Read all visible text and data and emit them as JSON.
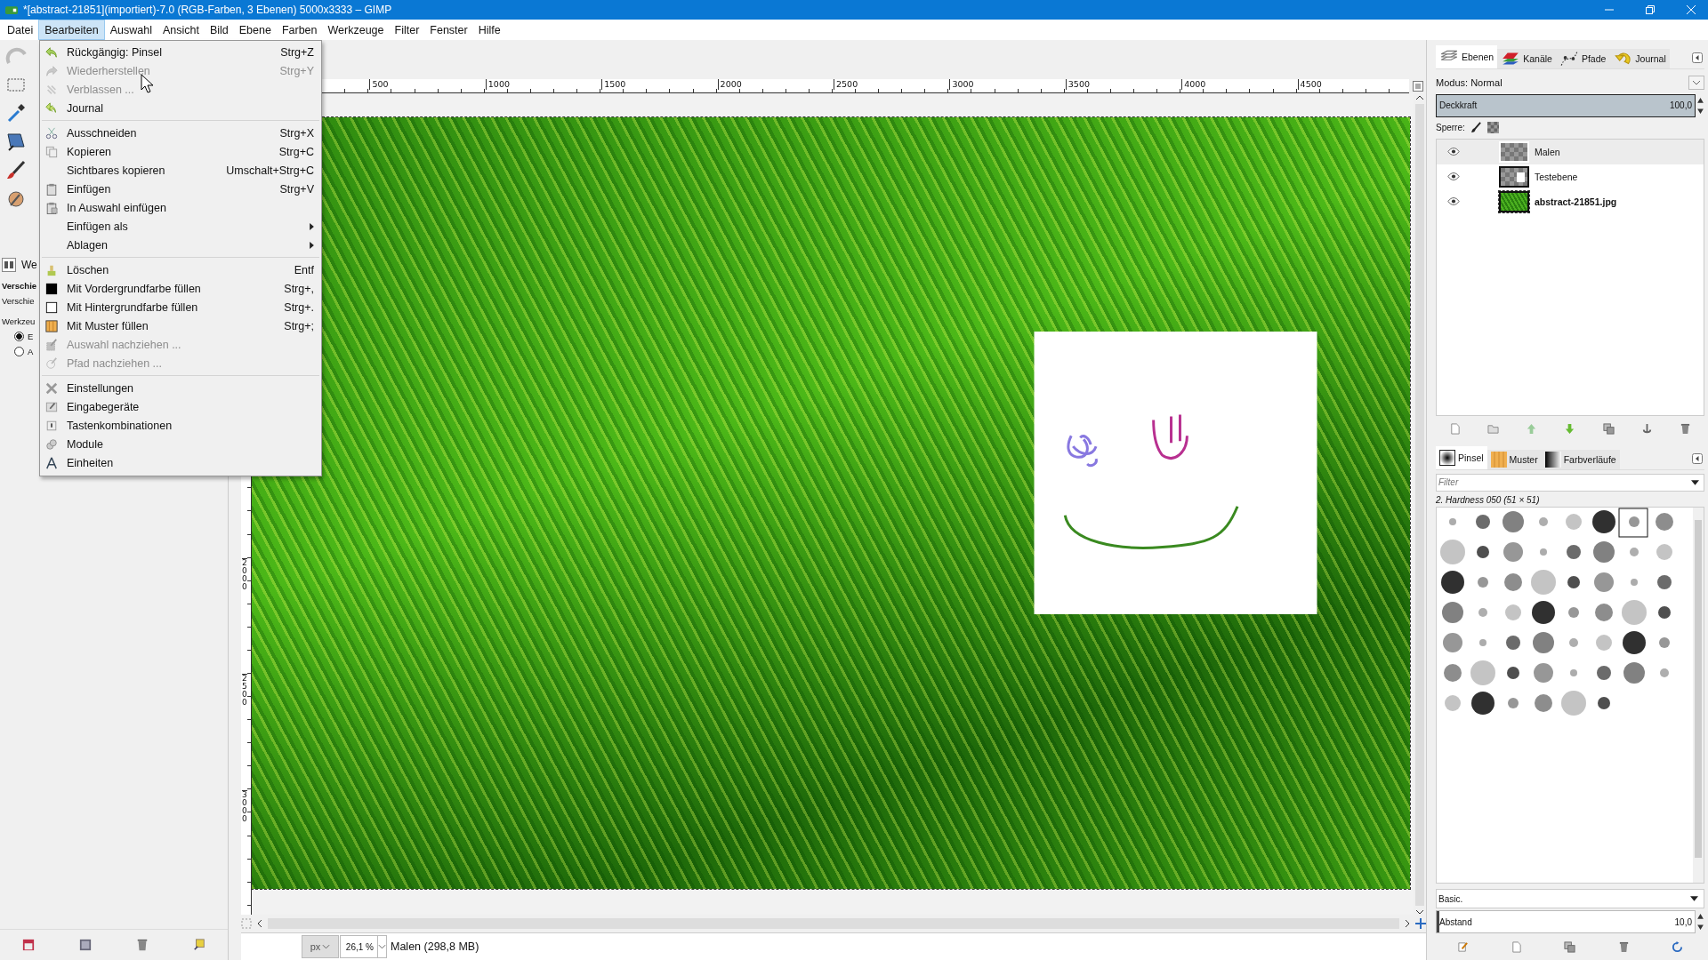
{
  "window": {
    "title": "*[abstract-21851](importiert)-7.0 (RGB-Farben, 3 Ebenen) 5000x3333 – GIMP"
  },
  "menubar": [
    {
      "label": "Datei",
      "selected": false
    },
    {
      "label": "Bearbeiten",
      "selected": true
    },
    {
      "label": "Auswahl",
      "selected": false
    },
    {
      "label": "Ansicht",
      "selected": false
    },
    {
      "label": "Bild",
      "selected": false
    },
    {
      "label": "Ebene",
      "selected": false
    },
    {
      "label": "Farben",
      "selected": false
    },
    {
      "label": "Werkzeuge",
      "selected": false
    },
    {
      "label": "Filter",
      "selected": false
    },
    {
      "label": "Fenster",
      "selected": false
    },
    {
      "label": "Hilfe",
      "selected": false
    }
  ],
  "edit_menu": {
    "sections": [
      [
        {
          "kind": "undo",
          "label": "Rückgängig: Pinsel",
          "shortcut": "Strg+Z",
          "disabled": false
        },
        {
          "kind": "redo",
          "label": "Wiederherstellen",
          "shortcut": "Strg+Y",
          "disabled": true
        },
        {
          "kind": "fade",
          "label": "Verblassen ...",
          "disabled": true
        },
        {
          "kind": "journal",
          "label": "Journal",
          "disabled": false
        }
      ],
      [
        {
          "kind": "cut",
          "label": "Ausschneiden",
          "shortcut": "Strg+X",
          "disabled": false
        },
        {
          "kind": "copy",
          "label": "Kopieren",
          "shortcut": "Strg+C",
          "disabled": false
        },
        {
          "kind": "plain",
          "label": "Sichtbares kopieren",
          "shortcut": "Umschalt+Strg+C",
          "disabled": false
        },
        {
          "kind": "paste",
          "label": "Einfügen",
          "shortcut": "Strg+V",
          "disabled": false
        },
        {
          "kind": "paste-into",
          "label": "In Auswahl einfügen",
          "disabled": false
        },
        {
          "kind": "plain",
          "label": "Einfügen als",
          "disabled": false,
          "submenu": true
        },
        {
          "kind": "plain",
          "label": "Ablagen",
          "disabled": false,
          "submenu": true
        }
      ],
      [
        {
          "kind": "clear",
          "label": "Löschen",
          "shortcut": "Entf",
          "disabled": false
        },
        {
          "kind": "fill-fg",
          "label": "Mit Vordergrundfarbe füllen",
          "shortcut": "Strg+,",
          "disabled": false
        },
        {
          "kind": "fill-bg",
          "label": "Mit Hintergrundfarbe füllen",
          "shortcut": "Strg+.",
          "disabled": false
        },
        {
          "kind": "fill-pattern",
          "label": "Mit Muster füllen",
          "shortcut": "Strg+;",
          "disabled": false
        },
        {
          "kind": "stroke-selection",
          "label": "Auswahl nachziehen ...",
          "disabled": true
        },
        {
          "kind": "stroke-path",
          "label": "Pfad nachziehen ...",
          "disabled": true
        }
      ],
      [
        {
          "kind": "preferences",
          "label": "Einstellungen",
          "disabled": false
        },
        {
          "kind": "input-devices",
          "label": "Eingabegeräte",
          "disabled": false
        },
        {
          "kind": "shortcuts",
          "label": "Tastenkombinationen",
          "disabled": false
        },
        {
          "kind": "modules",
          "label": "Module",
          "disabled": false
        },
        {
          "kind": "units",
          "label": "Einheiten",
          "disabled": false
        }
      ]
    ]
  },
  "tool_options": {
    "tab_label": "We",
    "title": "Verschie",
    "subtitle": "Verschie",
    "group_label": "Werkzeu",
    "radios": [
      {
        "label": "E",
        "selected": true
      },
      {
        "label": "A",
        "selected": false
      }
    ]
  },
  "canvas": {
    "ruler_h": [
      "500",
      "1000",
      "1500",
      "2000",
      "2500",
      "3000",
      "3500",
      "4000",
      "4500"
    ],
    "ruler_v": [
      "2000",
      "2500",
      "3000"
    ]
  },
  "status_bar": {
    "unit": "px",
    "zoom": "26,1 %",
    "info": "Malen (298,8 MB)"
  },
  "layers_dock": {
    "tabs": [
      {
        "kind": "layers",
        "label": "Ebenen",
        "selected": true
      },
      {
        "kind": "channels",
        "label": "Kanäle",
        "selected": false
      },
      {
        "kind": "paths",
        "label": "Pfade",
        "selected": false
      },
      {
        "kind": "history",
        "label": "Journal",
        "selected": false
      }
    ],
    "mode": "Modus: Normal",
    "opacity": {
      "label": "Deckkraft",
      "value": "100,0",
      "level": 1
    },
    "lock_label": "Sperre:",
    "layers": [
      {
        "kind": "transparent",
        "name": "Malen",
        "selected": true,
        "visible": true,
        "has_alpha": true
      },
      {
        "kind": "white-square",
        "name": "Testebene",
        "selected": false,
        "visible": true,
        "has_alpha": true
      },
      {
        "kind": "photo",
        "name": "abstract-21851.jpg",
        "selected": false,
        "visible": true,
        "has_alpha": false
      }
    ]
  },
  "brushes_dock": {
    "tabs": [
      {
        "kind": "brush",
        "label": "Pinsel",
        "selected": true
      },
      {
        "kind": "pattern",
        "label": "Muster",
        "selected": false
      },
      {
        "kind": "gradient",
        "label": "Farbverläufe",
        "selected": false
      }
    ],
    "filter": {
      "placeholder": "Filter"
    },
    "brush_name": "2. Hardness 050 (51 × 51)",
    "preset": "Basic.",
    "spacing": {
      "label": "Abstand",
      "value": "10,0",
      "level": 0.01
    }
  }
}
